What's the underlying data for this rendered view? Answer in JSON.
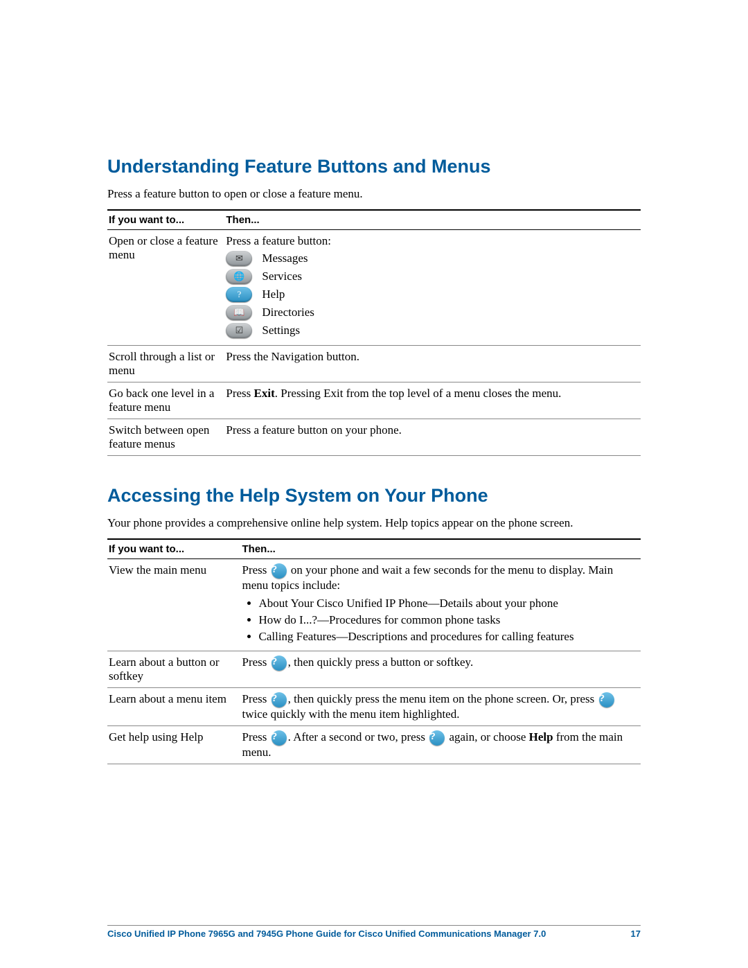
{
  "section1": {
    "heading": "Understanding Feature Buttons and Menus",
    "intro": "Press a feature button to open or close a feature menu.",
    "headers": {
      "col1": "If you want to...",
      "col2": "Then..."
    },
    "rows": {
      "r1": {
        "want": "Open or close a feature menu",
        "then_lead": "Press a feature button:",
        "buttons": {
          "messages": "Messages",
          "services": "Services",
          "help": "Help",
          "directories": "Directories",
          "settings": "Settings"
        }
      },
      "r2": {
        "want": "Scroll through a list or menu",
        "then": "Press the Navigation button."
      },
      "r3": {
        "want": "Go back one level in a feature menu",
        "then_pre": "Press ",
        "then_bold": "Exit",
        "then_post": ". Pressing Exit from the top level of a menu closes the menu."
      },
      "r4": {
        "want": "Switch between open feature menus",
        "then": "Press a feature button on your phone."
      }
    }
  },
  "section2": {
    "heading": "Accessing the Help System on Your Phone",
    "intro": "Your phone provides a comprehensive online help system. Help topics appear on the phone screen.",
    "headers": {
      "col1": "If you want to...",
      "col2": "Then..."
    },
    "rows": {
      "r1": {
        "want": "View the main menu",
        "then_pre": "Press ",
        "then_post": " on your phone and wait a few seconds for the menu to display. Main menu topics include:",
        "bullets": {
          "b1": "About Your Cisco Unified IP Phone—Details about your phone",
          "b2": "How do I...?—Procedures for common phone tasks",
          "b3": "Calling Features—Descriptions and procedures for calling features"
        }
      },
      "r2": {
        "want": "Learn about a button or softkey",
        "then_pre": "Press ",
        "then_post": ", then quickly press a button or softkey."
      },
      "r3": {
        "want": "Learn about a menu item",
        "then_pre": "Press ",
        "then_mid": ", then quickly press the menu item on the phone screen. Or, press ",
        "then_post": " twice quickly with the menu item highlighted."
      },
      "r4": {
        "want": "Get help using Help",
        "then_pre": "Press ",
        "then_mid": ". After a second or two, press ",
        "then_post1": " again, or choose ",
        "then_bold": "Help",
        "then_post2": " from the main menu."
      }
    }
  },
  "icons": {
    "messages_glyph": "✉",
    "services_glyph": "🌐",
    "help_glyph": "?",
    "directories_glyph": "📖",
    "settings_glyph": "☑"
  },
  "footer": {
    "title": "Cisco Unified IP Phone 7965G and 7945G Phone Guide for Cisco Unified Communications Manager 7.0",
    "page": "17"
  }
}
